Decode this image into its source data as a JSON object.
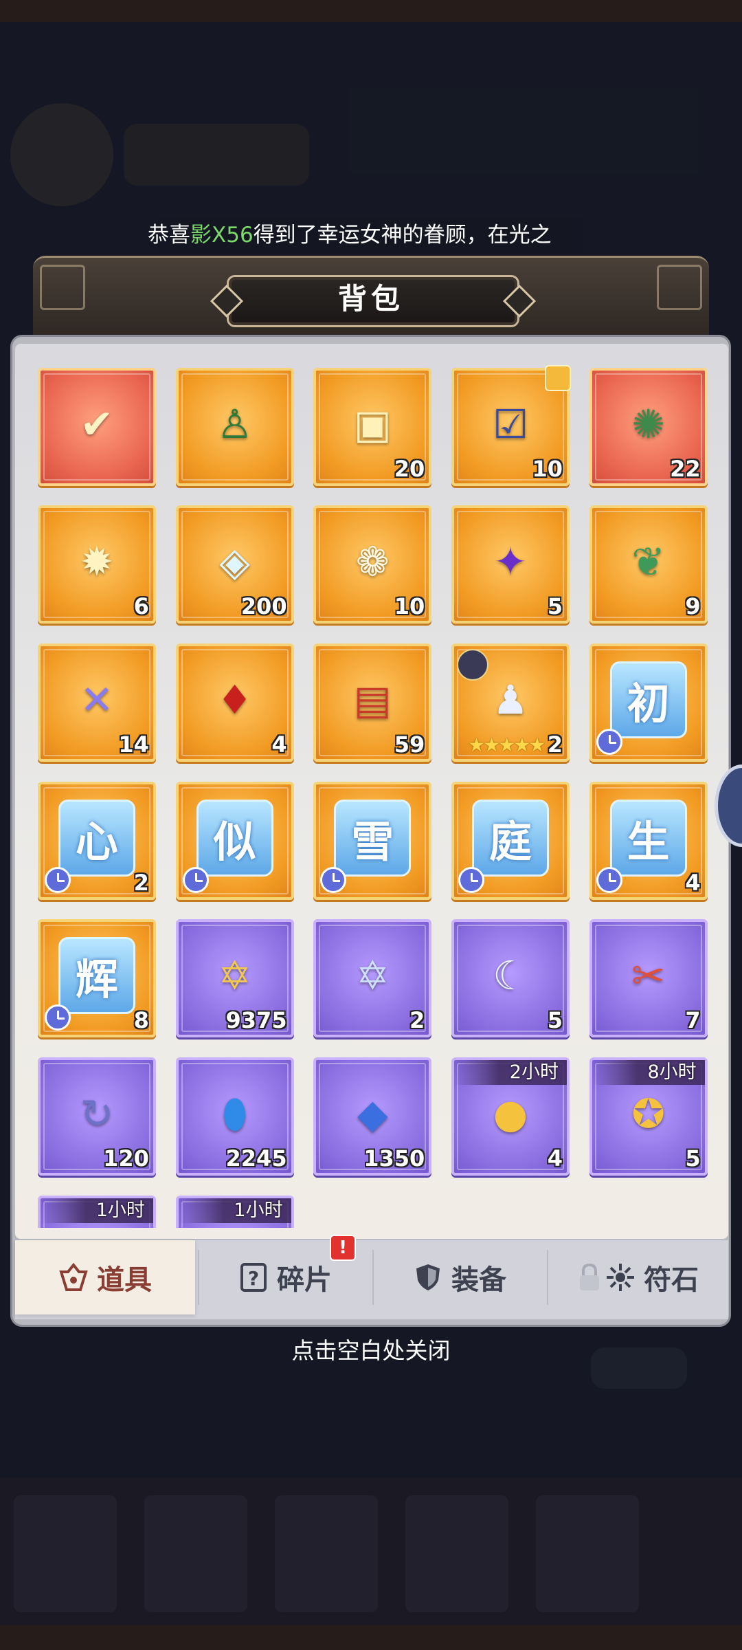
{
  "marquee": {
    "prefix": "恭喜",
    "player": "影X56",
    "suffix": "得到了幸运女神的眷顾，在光之",
    "highlight_color": "#7bd86a"
  },
  "panel": {
    "title": "背包",
    "close_hint": "点击空白处关闭"
  },
  "items": [
    {
      "qty": "",
      "bg": "red",
      "icon": "treasure-chest-check-icon"
    },
    {
      "qty": "",
      "bg": "gold",
      "icon": "hero-card-icon"
    },
    {
      "qty": "20",
      "bg": "gold",
      "icon": "golden-chest-icon"
    },
    {
      "qty": "10",
      "bg": "gold",
      "icon": "card-pack-selector-icon",
      "puzzle": true
    },
    {
      "qty": "22",
      "bg": "red",
      "icon": "emblem-badge-icon"
    },
    {
      "qty": "6",
      "bg": "gold",
      "icon": "gold-ticket-icon"
    },
    {
      "qty": "200",
      "bg": "gold",
      "icon": "crystal-drop-icon"
    },
    {
      "qty": "10",
      "bg": "gold",
      "icon": "diamond-flower-icon"
    },
    {
      "qty": "5",
      "bg": "gold",
      "icon": "purple-planet-orb-icon"
    },
    {
      "qty": "9",
      "bg": "gold",
      "icon": "green-cabbage-icon"
    },
    {
      "qty": "14",
      "bg": "gold",
      "icon": "crossed-crystals-icon"
    },
    {
      "qty": "4",
      "bg": "gold",
      "icon": "red-gem-crown-icon"
    },
    {
      "qty": "59",
      "bg": "gold",
      "icon": "canned-food-icon"
    },
    {
      "qty": "2",
      "bg": "gold",
      "icon": "hero-figure-icon",
      "stars": "★★★★★",
      "badge": true
    },
    {
      "qty": "",
      "bg": "gold",
      "icon": "rune-tile-icon",
      "rune": "初",
      "timer": true
    },
    {
      "qty": "2",
      "bg": "gold",
      "icon": "rune-tile-icon",
      "rune": "心",
      "timer": true
    },
    {
      "qty": "",
      "bg": "gold",
      "icon": "rune-tile-icon",
      "rune": "似",
      "timer": true
    },
    {
      "qty": "",
      "bg": "gold",
      "icon": "rune-tile-icon",
      "rune": "雪",
      "timer": true
    },
    {
      "qty": "",
      "bg": "gold",
      "icon": "rune-tile-icon",
      "rune": "庭",
      "timer": true
    },
    {
      "qty": "4",
      "bg": "gold",
      "icon": "rune-tile-icon",
      "rune": "生",
      "timer": true
    },
    {
      "qty": "8",
      "bg": "gold",
      "icon": "rune-tile-icon",
      "rune": "辉",
      "timer": true
    },
    {
      "qty": "9375",
      "bg": "purple",
      "icon": "star-medallion-icon"
    },
    {
      "qty": "2",
      "bg": "purple",
      "icon": "hexagram-book-icon"
    },
    {
      "qty": "5",
      "bg": "purple",
      "icon": "crescent-moon-icon"
    },
    {
      "qty": "7",
      "bg": "purple",
      "icon": "red-ticket-icon"
    },
    {
      "qty": "120",
      "bg": "purple",
      "icon": "refresh-scroll-icon"
    },
    {
      "qty": "2245",
      "bg": "purple",
      "icon": "blue-mirror-icon"
    },
    {
      "qty": "1350",
      "bg": "purple",
      "icon": "blue-crystal-icon"
    },
    {
      "qty": "4",
      "bg": "purple",
      "icon": "gold-coins-icon",
      "time": "2小时"
    },
    {
      "qty": "5",
      "bg": "purple",
      "icon": "coin-bag-icon",
      "time": "8小时"
    },
    {
      "qty": "",
      "bg": "purple",
      "icon": "partial-item-icon",
      "time": "1小时"
    },
    {
      "qty": "",
      "bg": "purple",
      "icon": "partial-item-icon",
      "time": "1小时"
    }
  ],
  "tabs": [
    {
      "label": "道具",
      "icon": "item-bag-icon",
      "active": true
    },
    {
      "label": "碎片",
      "icon": "question-card-icon",
      "alert": "!"
    },
    {
      "label": "装备",
      "icon": "shield-icon"
    },
    {
      "label": "符石",
      "icon": "rune-star-icon",
      "locked": true
    }
  ],
  "colors": {
    "gold_slot": "#f19a22",
    "red_slot": "#e8634e",
    "purple_slot": "#8a6ddf",
    "active_tab_text": "#8a3e33"
  }
}
